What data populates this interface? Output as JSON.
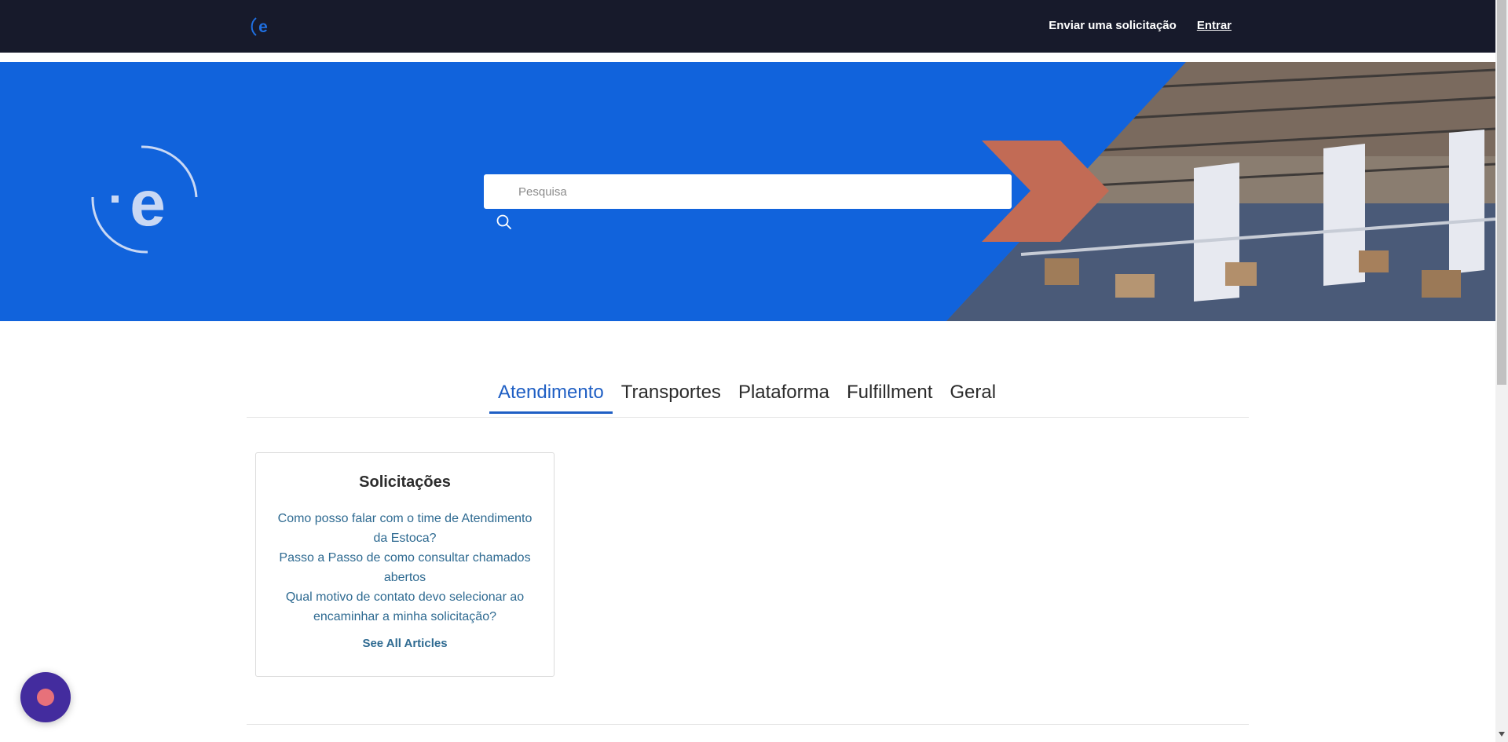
{
  "nav": {
    "logo_icon": "estoca-logo-icon",
    "submit_request": "Enviar uma solicitação",
    "sign_in": "Entrar"
  },
  "hero": {
    "background_color": "#1163dc",
    "accent_color": "#c26b55",
    "search_placeholder": "Pesquisa",
    "search_icon": "search-icon"
  },
  "tabs": [
    {
      "label": "Atendimento",
      "active": true
    },
    {
      "label": "Transportes",
      "active": false
    },
    {
      "label": "Plataforma",
      "active": false
    },
    {
      "label": "Fulfillment",
      "active": false
    },
    {
      "label": "Geral",
      "active": false
    }
  ],
  "section": {
    "title": "Solicitações",
    "articles": [
      "Como posso falar com o time de Atendimento da Estoca?",
      "Passo a Passo de como consultar chamados abertos",
      "Qual motivo de contato devo selecionar ao encaminhar a minha solicitação?"
    ],
    "see_all": "See All Articles"
  },
  "colors": {
    "nav_bg": "#171a2b",
    "active_tab": "#1f5fc4",
    "link": "#2e6a91",
    "chat_button": "#432c9e",
    "chat_dot": "#e7717a"
  }
}
